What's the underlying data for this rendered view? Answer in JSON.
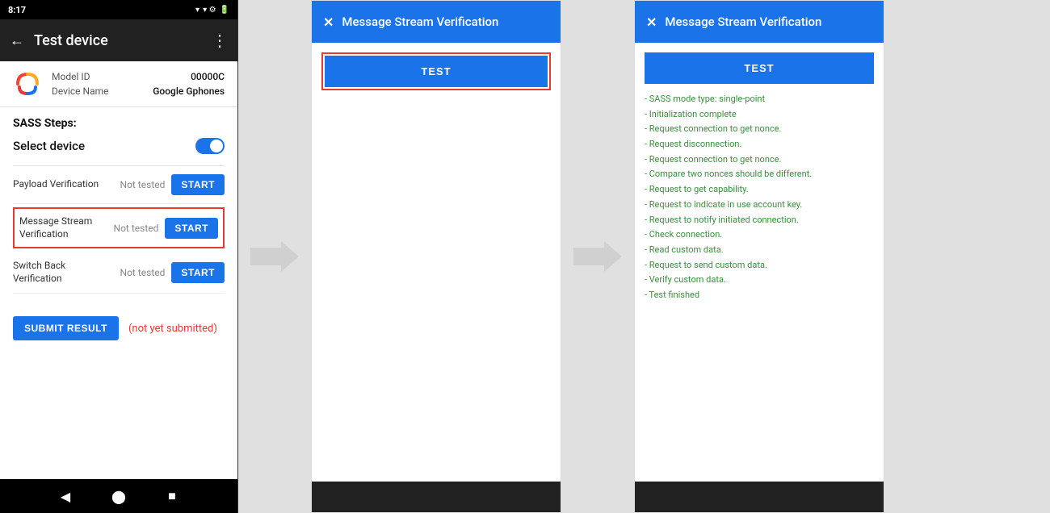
{
  "statusBar": {
    "time": "8:17",
    "rightIcons": "▾ ⬡ ⚙ ✦ •"
  },
  "appBar": {
    "backIcon": "←",
    "title": "Test device",
    "menuIcon": "⋮"
  },
  "deviceInfo": {
    "modelIdLabel": "Model ID",
    "modelIdValue": "00000C",
    "deviceNameLabel": "Device Name",
    "deviceNameValue": "Google Gphones"
  },
  "sass": {
    "title": "SASS Steps:",
    "selectDeviceLabel": "Select device",
    "rows": [
      {
        "name": "Payload Verification",
        "status": "Not tested",
        "btnLabel": "START"
      },
      {
        "name": "Message Stream\nVerification",
        "status": "Not tested",
        "btnLabel": "START",
        "highlighted": true
      },
      {
        "name": "Switch Back Verification",
        "status": "Not tested",
        "btnLabel": "START"
      }
    ],
    "submitLabel": "SUBMIT RESULT",
    "notSubmitted": "(not yet submitted)"
  },
  "dialogs": [
    {
      "id": "dialog1",
      "title": "Message Stream Verification",
      "closeIcon": "✕",
      "testLabel": "TEST",
      "showOutline": true,
      "resultLines": []
    },
    {
      "id": "dialog2",
      "title": "Message Stream Verification",
      "closeIcon": "✕",
      "testLabel": "TEST",
      "showOutline": false,
      "resultLines": [
        "- SASS mode type: single-point",
        "- Initialization complete",
        "- Request connection to get nonce.",
        "- Request disconnection.",
        "- Request connection to get nonce.",
        "- Compare two nonces should be different.",
        "- Request to get capability.",
        "- Request to indicate in use account key.",
        "- Request to notify initiated connection.",
        "- Check connection.",
        "- Read custom data.",
        "- Request to send custom data.",
        "- Verify custom data.",
        "- Test finished"
      ]
    }
  ],
  "arrows": {
    "label": "→"
  }
}
